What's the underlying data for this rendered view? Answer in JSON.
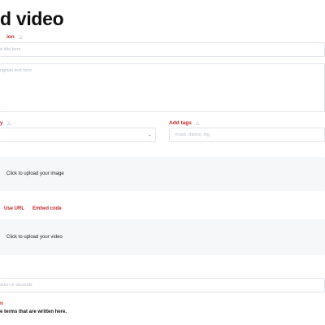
{
  "page": {
    "title": "d video"
  },
  "description_field": {
    "label": "ion",
    "placeholder": "d title here"
  },
  "body_field": {
    "placeholder": "rigitian text here"
  },
  "category_field": {
    "label": "y",
    "chevron": "chevron-down-icon"
  },
  "tags_field": {
    "label": "Add tags",
    "placeholder": "music, dance, log"
  },
  "image_upload": {
    "label": "Click to upload your image"
  },
  "video_source": {
    "tabs": [
      "Use URL",
      "Embed code"
    ]
  },
  "video_upload": {
    "label": "Click to upload your video"
  },
  "duration_field": {
    "placeholder": "ation in seconds"
  },
  "terms": {
    "label": "n",
    "text": "e terms that are written here."
  },
  "colors": {
    "accent": "#c0282d",
    "upload_bg": "#f6f7f9",
    "border": "#e3e6ea"
  }
}
